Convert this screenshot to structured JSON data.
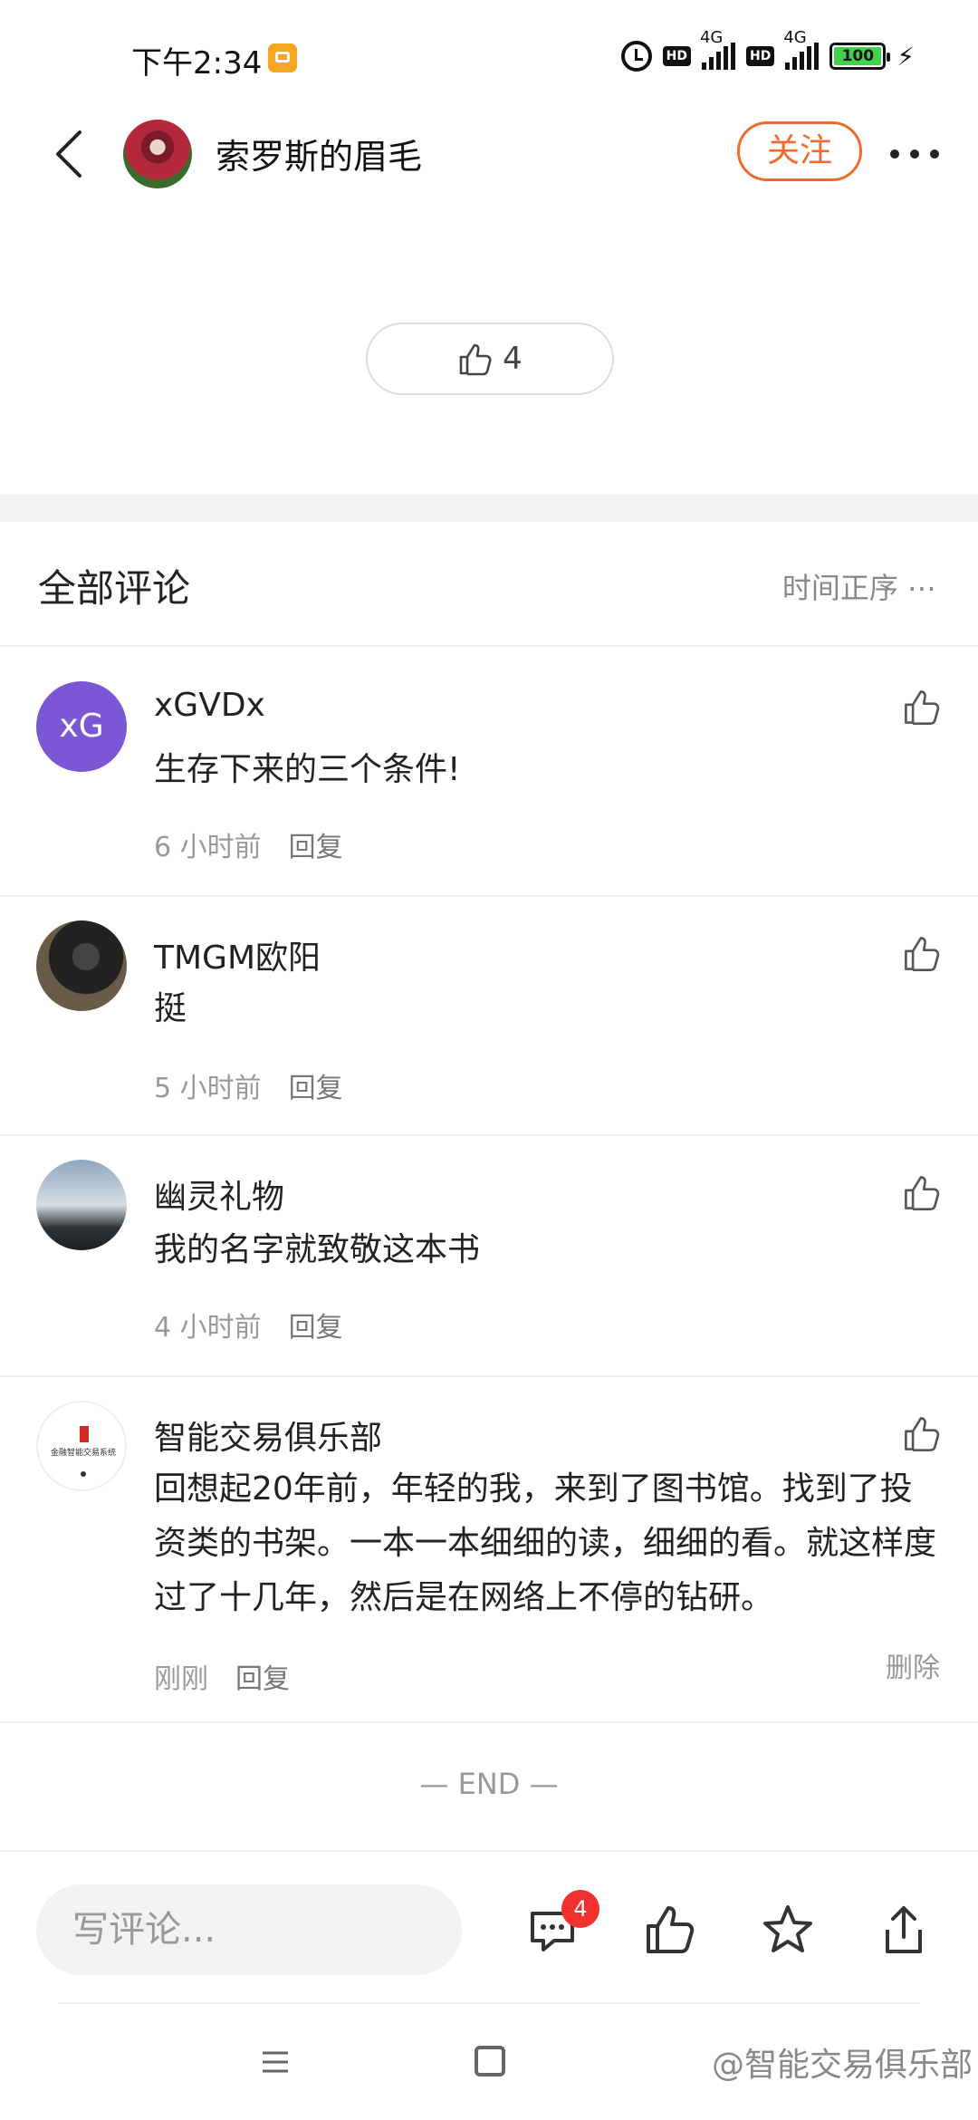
{
  "status_bar": {
    "time": "下午2:34",
    "battery": "100",
    "network_1": "4G",
    "network_2": "4G",
    "hd_label": "HD"
  },
  "header": {
    "author_name": "索罗斯的眉毛",
    "follow_label": "关注"
  },
  "post": {
    "like_count": "4"
  },
  "comments_section": {
    "title": "全部评论",
    "sort_label": "时间正序 ⋯"
  },
  "comments": [
    {
      "avatar_text": "xG",
      "name": "xGVDx",
      "text": "生存下来的三个条件!",
      "time": "6 小时前",
      "reply_label": "回复"
    },
    {
      "name": "TMGM欧阳",
      "text": "挺",
      "time": "5 小时前",
      "reply_label": "回复"
    },
    {
      "name": "幽灵礼物",
      "text": "我的名字就致敬这本书",
      "time": "4 小时前",
      "reply_label": "回复"
    },
    {
      "name": "智能交易俱乐部",
      "avatar_label": "金融智能交易系统",
      "text": "回想起20年前，年轻的我，来到了图书馆。找到了投资类的书架。一本一本细细的读，细细的看。就这样度过了十几年，然后是在网络上不停的钻研。",
      "time": "刚刚",
      "reply_label": "回复",
      "delete_label": "删除"
    }
  ],
  "end_text": "— END —",
  "bottom_bar": {
    "input_placeholder": "写评论...",
    "comment_badge": "4"
  },
  "watermark": "@智能交易俱乐部",
  "colors": {
    "accent": "#f26b2d",
    "badge": "#f23030",
    "avatar_purple": "#7b57d6"
  }
}
